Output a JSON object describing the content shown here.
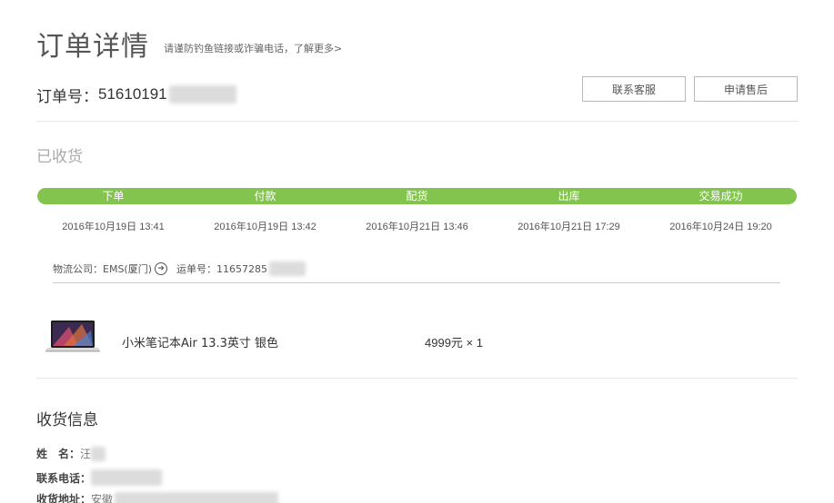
{
  "header": {
    "title": "订单详情",
    "warning": "请谨防钓鱼链接或诈骗电话，了解更多>"
  },
  "order": {
    "label": "订单号：",
    "number_visible": "51610191"
  },
  "actions": {
    "contact_service": "联系客服",
    "apply_aftersale": "申请售后"
  },
  "status": "已收货",
  "progress": {
    "steps": [
      {
        "label": "下单",
        "time": "2016年10月19日 13:41"
      },
      {
        "label": "付款",
        "time": "2016年10月19日 13:42"
      },
      {
        "label": "配货",
        "time": "2016年10月21日 13:46"
      },
      {
        "label": "出库",
        "time": "2016年10月21日 17:29"
      },
      {
        "label": "交易成功",
        "time": "2016年10月24日 19:20"
      }
    ],
    "color": "#83c44e"
  },
  "logistics": {
    "company_label": "物流公司：",
    "company": "EMS(厦门)",
    "tracking_label": "运单号：",
    "tracking_visible": "11657285"
  },
  "product": {
    "name": "小米笔记本Air 13.3英寸 银色",
    "price_qty": "4999元 × 1"
  },
  "shipping": {
    "title": "收货信息",
    "name_label": "姓　名：",
    "name_visible": "汪",
    "phone_label": "联系电话：",
    "address_label": "收货地址：",
    "address_visible": "安徽"
  }
}
